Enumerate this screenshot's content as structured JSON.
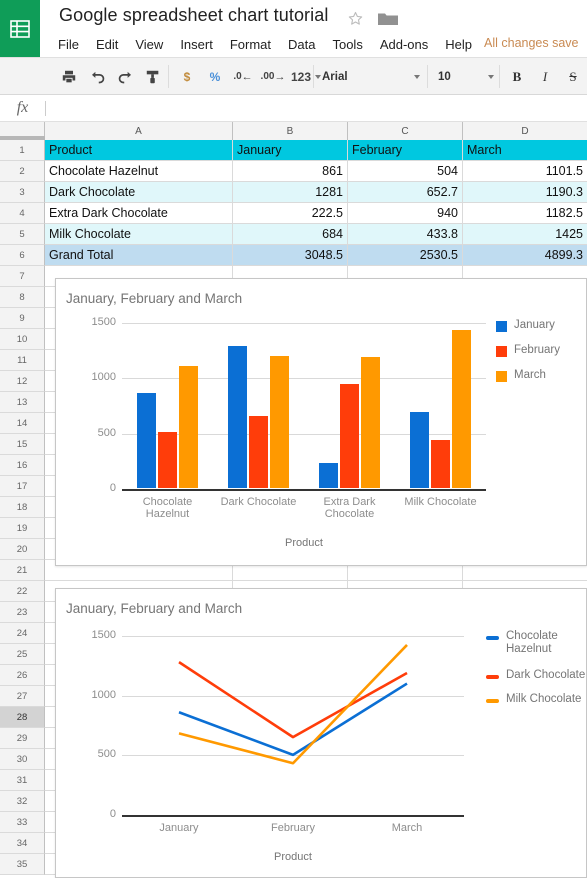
{
  "app": {
    "logo_icon": "sheets-grid-icon",
    "doc_title": "Google spreadsheet chart tutorial",
    "star_icon": "star-outline-icon",
    "folder_icon": "folder-icon",
    "save_status": "All changes save",
    "menu_items": [
      "File",
      "Edit",
      "View",
      "Insert",
      "Format",
      "Data",
      "Tools",
      "Add-ons",
      "Help"
    ]
  },
  "toolbar": {
    "print_icon": "print-icon",
    "undo_icon": "undo-icon",
    "redo_icon": "redo-icon",
    "paint_format_icon": "paint-format-icon",
    "currency_label": "$",
    "percent_label": "%",
    "decrease_decimal_label": ".0",
    "increase_decimal_label": ".00",
    "number_format_label": "123",
    "font_family_value": "Arial",
    "font_size_value": "10",
    "bold_label": "B",
    "italic_label": "I",
    "strikethrough_label": "S"
  },
  "formula_bar": {
    "fx_label": "fx",
    "value": ""
  },
  "grid": {
    "columns": [
      "A",
      "B",
      "C",
      "D"
    ],
    "rows": [
      "1",
      "2",
      "3",
      "4",
      "5",
      "6",
      "7",
      "8",
      "9",
      "10",
      "11",
      "12",
      "13",
      "14",
      "15",
      "16",
      "17",
      "18",
      "19",
      "20",
      "21",
      "22",
      "23",
      "24",
      "25",
      "26",
      "27",
      "28",
      "29",
      "30",
      "31",
      "32",
      "33",
      "34",
      "35"
    ],
    "selected_row": "28",
    "table": {
      "headers": [
        "Product",
        "January",
        "February",
        "March"
      ],
      "rows": [
        [
          "Chocolate Hazelnut",
          "861",
          "504",
          "1101.5"
        ],
        [
          "Dark Chocolate",
          "1281",
          "652.7",
          "1190.3"
        ],
        [
          "Extra Dark Chocolate",
          "222.5",
          "940",
          "1182.5"
        ],
        [
          "Milk Chocolate",
          "684",
          "433.8",
          "1425"
        ],
        [
          "Grand Total",
          "3048.5",
          "2530.5",
          "4899.3"
        ]
      ]
    },
    "colors": {
      "header_fill": "#00c8e0",
      "alt_fill": "#e0f7fa",
      "total_fill": "#bfdcf0"
    }
  },
  "chart_data": [
    {
      "type": "bar",
      "title": "January, February and March",
      "xlabel": "Product",
      "ylabel": "",
      "categories": [
        "Chocolate\nHazelnut",
        "Dark Chocolate",
        "Extra Dark\nChocolate",
        "Milk Chocolate"
      ],
      "series": [
        {
          "name": "January",
          "color": "#0b6fd4",
          "values": [
            861,
            1281,
            222.5,
            684
          ]
        },
        {
          "name": "February",
          "color": "#ff3d0a",
          "values": [
            504,
            652.7,
            940,
            433.8
          ]
        },
        {
          "name": "March",
          "color": "#ff9900",
          "values": [
            1101.5,
            1190.3,
            1182.5,
            1425
          ]
        }
      ],
      "yticks": [
        0,
        500,
        1000,
        1500
      ],
      "ylim": [
        0,
        1500
      ],
      "grid": true,
      "legend_position": "right"
    },
    {
      "type": "line",
      "title": "January, February and March",
      "xlabel": "Product",
      "ylabel": "",
      "categories": [
        "January",
        "February",
        "March"
      ],
      "series": [
        {
          "name": "Chocolate\nHazelnut",
          "color": "#0b6fd4",
          "values": [
            861,
            504,
            1101.5
          ]
        },
        {
          "name": "Dark Chocolate",
          "color": "#ff3d0a",
          "values": [
            1281,
            652.7,
            1190.3
          ]
        },
        {
          "name": "Milk Chocolate",
          "color": "#ff9900",
          "values": [
            684,
            433.8,
            1425
          ]
        }
      ],
      "yticks": [
        0,
        500,
        1000,
        1500
      ],
      "ylim": [
        0,
        1500
      ],
      "grid": true,
      "legend_position": "right"
    }
  ]
}
